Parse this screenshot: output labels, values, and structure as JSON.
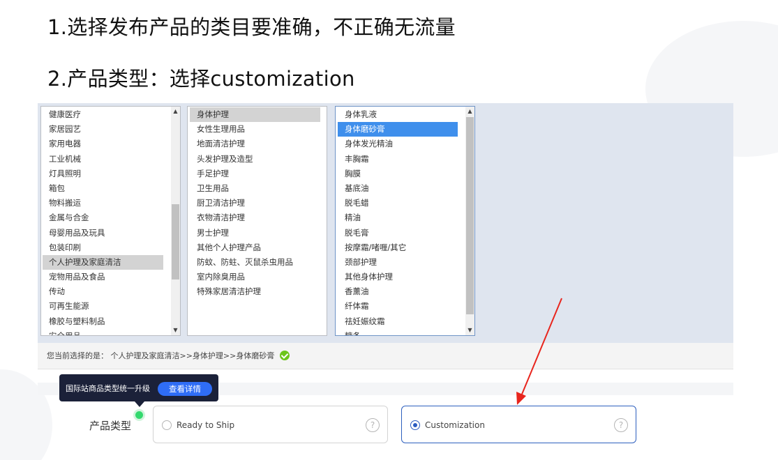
{
  "headings": {
    "line1": "1.选择发布产品的类目要准确，不正确无流量",
    "line2": "2.产品类型：选择customization"
  },
  "category_lists": {
    "level1": [
      "健康医疗",
      "家居园艺",
      "家用电器",
      "工业机械",
      "灯具照明",
      "箱包",
      "物料搬运",
      "金属与合金",
      "母婴用品及玩具",
      "包装印刷",
      "个人护理及家庭清洁",
      "宠物用品及食品",
      "传动",
      "可再生能源",
      "橡胶与塑料制品",
      "安全用品"
    ],
    "level1_selected": "个人护理及家庭清洁",
    "level2": [
      "身体护理",
      "女性生理用品",
      "地面清洁护理",
      "头发护理及造型",
      "手足护理",
      "卫生用品",
      "厨卫清洁护理",
      "衣物清洁护理",
      "男士护理",
      "其他个人护理产品",
      "防蚊、防蛀、灭鼠杀虫用品",
      "室内除臭用品",
      "特殊家居清洁护理"
    ],
    "level2_selected": "身体护理",
    "level3": [
      "身体乳液",
      "身体磨砂膏",
      "身体发光精油",
      "丰胸霜",
      "胸膜",
      "基底油",
      "脱毛蜡",
      "精油",
      "脱毛膏",
      "按摩霜/啫喱/其它",
      "颈部护理",
      "其他身体护理",
      "香薰油",
      "纤体霜",
      "祛妊娠纹霜",
      "糖条"
    ],
    "level3_selected": "身体磨砂膏"
  },
  "current_selection": {
    "prefix": "您当前选择的是：",
    "path": "个人护理及家庭清洁>>身体护理>>身体磨砂膏"
  },
  "tooltip": {
    "text": "国际站商品类型统一升级",
    "button": "查看详情"
  },
  "product_type": {
    "label": "产品类型",
    "options": [
      {
        "label": "Ready to Ship",
        "selected": false
      },
      {
        "label": "Customization",
        "selected": true
      }
    ],
    "help_symbol": "?"
  },
  "icons": {
    "scroll_up": "▲",
    "scroll_down": "▼",
    "check": "check-circle-icon",
    "help": "help-circle-icon"
  },
  "colors": {
    "accent_blue": "#2f6df6",
    "list_selected_blue": "#3f8fec",
    "panel_bg": "#dfe5ef",
    "tooltip_bg": "#1b2139",
    "check_green": "#6cc51a",
    "annotation_red": "#e8251d"
  }
}
